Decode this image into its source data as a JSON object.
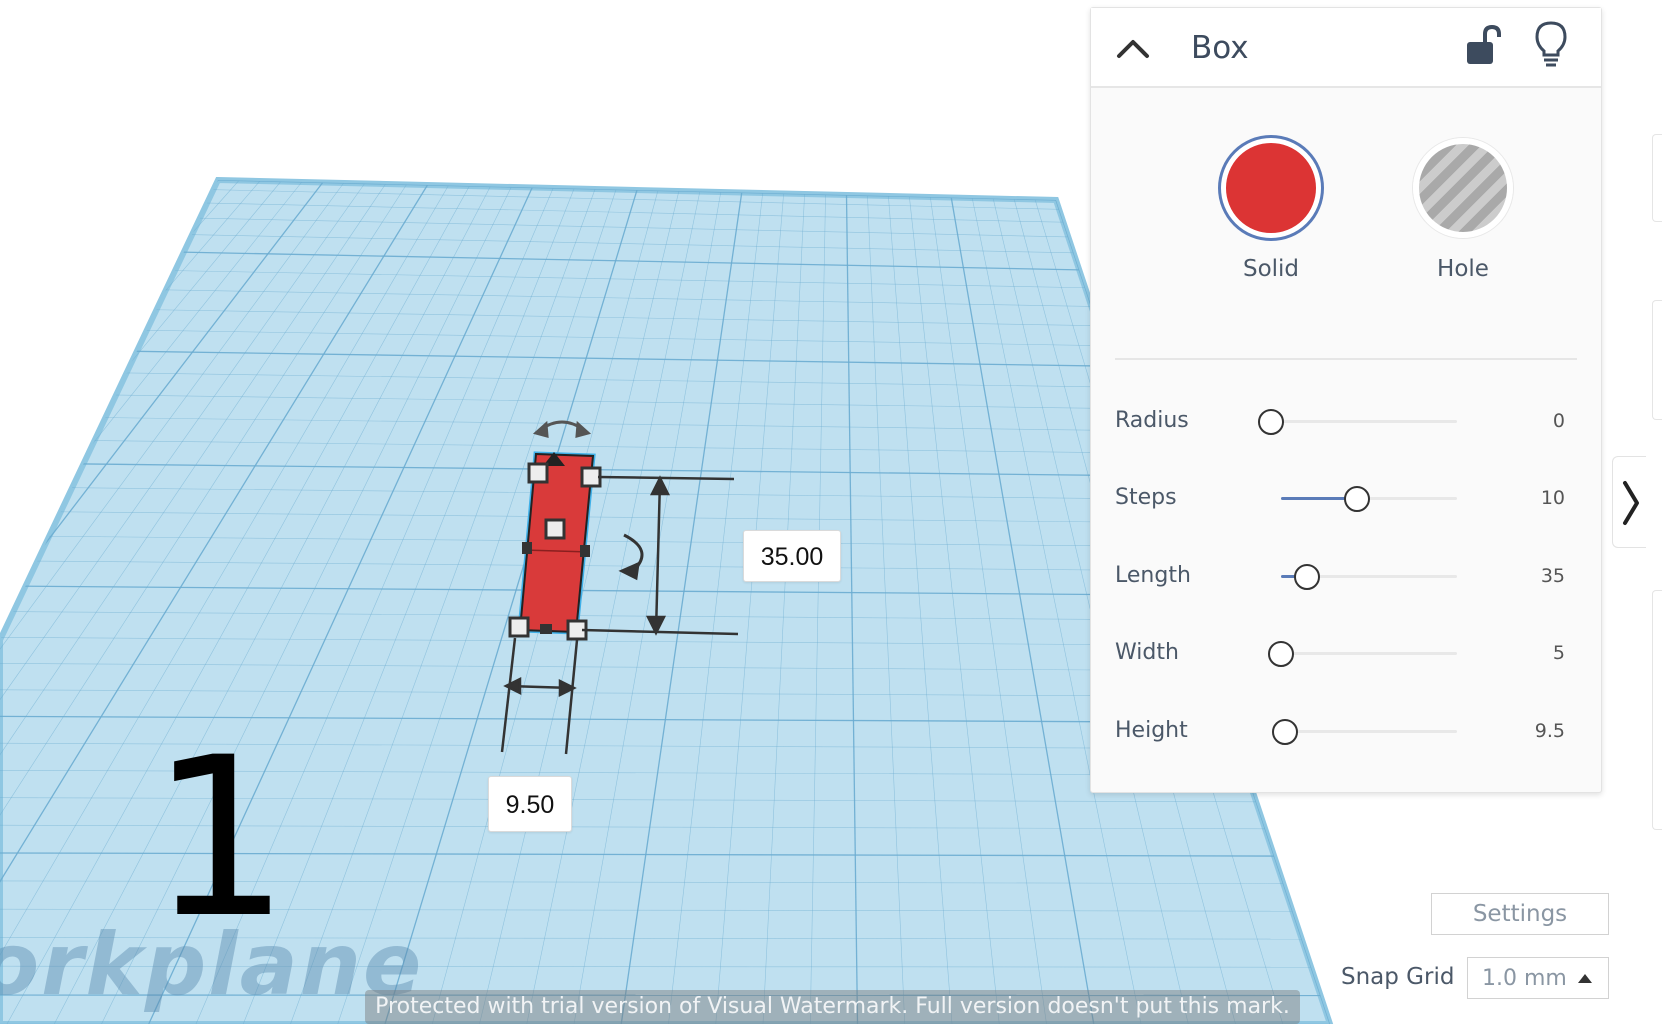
{
  "inspector": {
    "title": "Box",
    "modes": [
      {
        "label": "Solid",
        "selected": true
      },
      {
        "label": "Hole",
        "selected": false
      }
    ],
    "properties": [
      {
        "label": "Radius",
        "value": "0"
      },
      {
        "label": "Steps",
        "value": "10"
      },
      {
        "label": "Length",
        "value": "35"
      },
      {
        "label": "Width",
        "value": "5"
      },
      {
        "label": "Height",
        "value": "9.5"
      }
    ]
  },
  "viewport": {
    "length_dimension": "35.00",
    "width_dimension": "9.50",
    "view_number": "1",
    "workplane_label": "orkplane"
  },
  "controls": {
    "settings_label": "Settings",
    "snap_grid_label": "Snap Grid",
    "snap_grid_value": "1.0 mm"
  },
  "watermark": "Protected with trial version of Visual Watermark. Full version doesn't put this mark.",
  "colors": {
    "workplane": "#b9dcee",
    "grid_line": "#5fa4c6",
    "shape": "#d93a3a",
    "accent": "#5a7bb8"
  }
}
